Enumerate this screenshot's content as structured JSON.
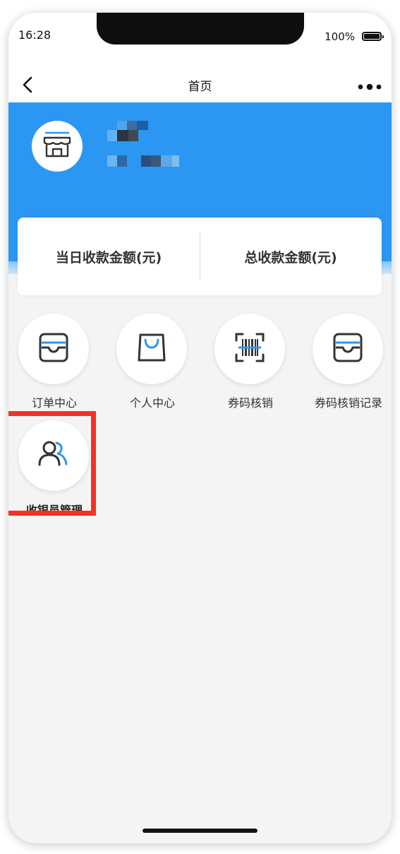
{
  "status_bar": {
    "time": "16:28",
    "battery": "100%"
  },
  "navbar": {
    "title": "首页",
    "back_icon": "chevron-left-icon",
    "more_icon": "more-dots-icon"
  },
  "store": {
    "avatar_icon": "store-icon"
  },
  "summary": {
    "today_label": "当日收款金额(元)",
    "total_label": "总收款金额(元)"
  },
  "menu": [
    {
      "label": "订单中心",
      "icon": "inbox-tray-icon"
    },
    {
      "label": "个人中心",
      "icon": "shopping-bag-icon"
    },
    {
      "label": "券码核销",
      "icon": "barcode-scan-icon"
    },
    {
      "label": "券码核销记录",
      "icon": "inbox-tray-icon"
    },
    {
      "label": "收银员管理",
      "icon": "users-icon"
    }
  ],
  "colors": {
    "primary": "#2b97f3",
    "highlight": "#f23322",
    "background": "#f4f4f4"
  }
}
